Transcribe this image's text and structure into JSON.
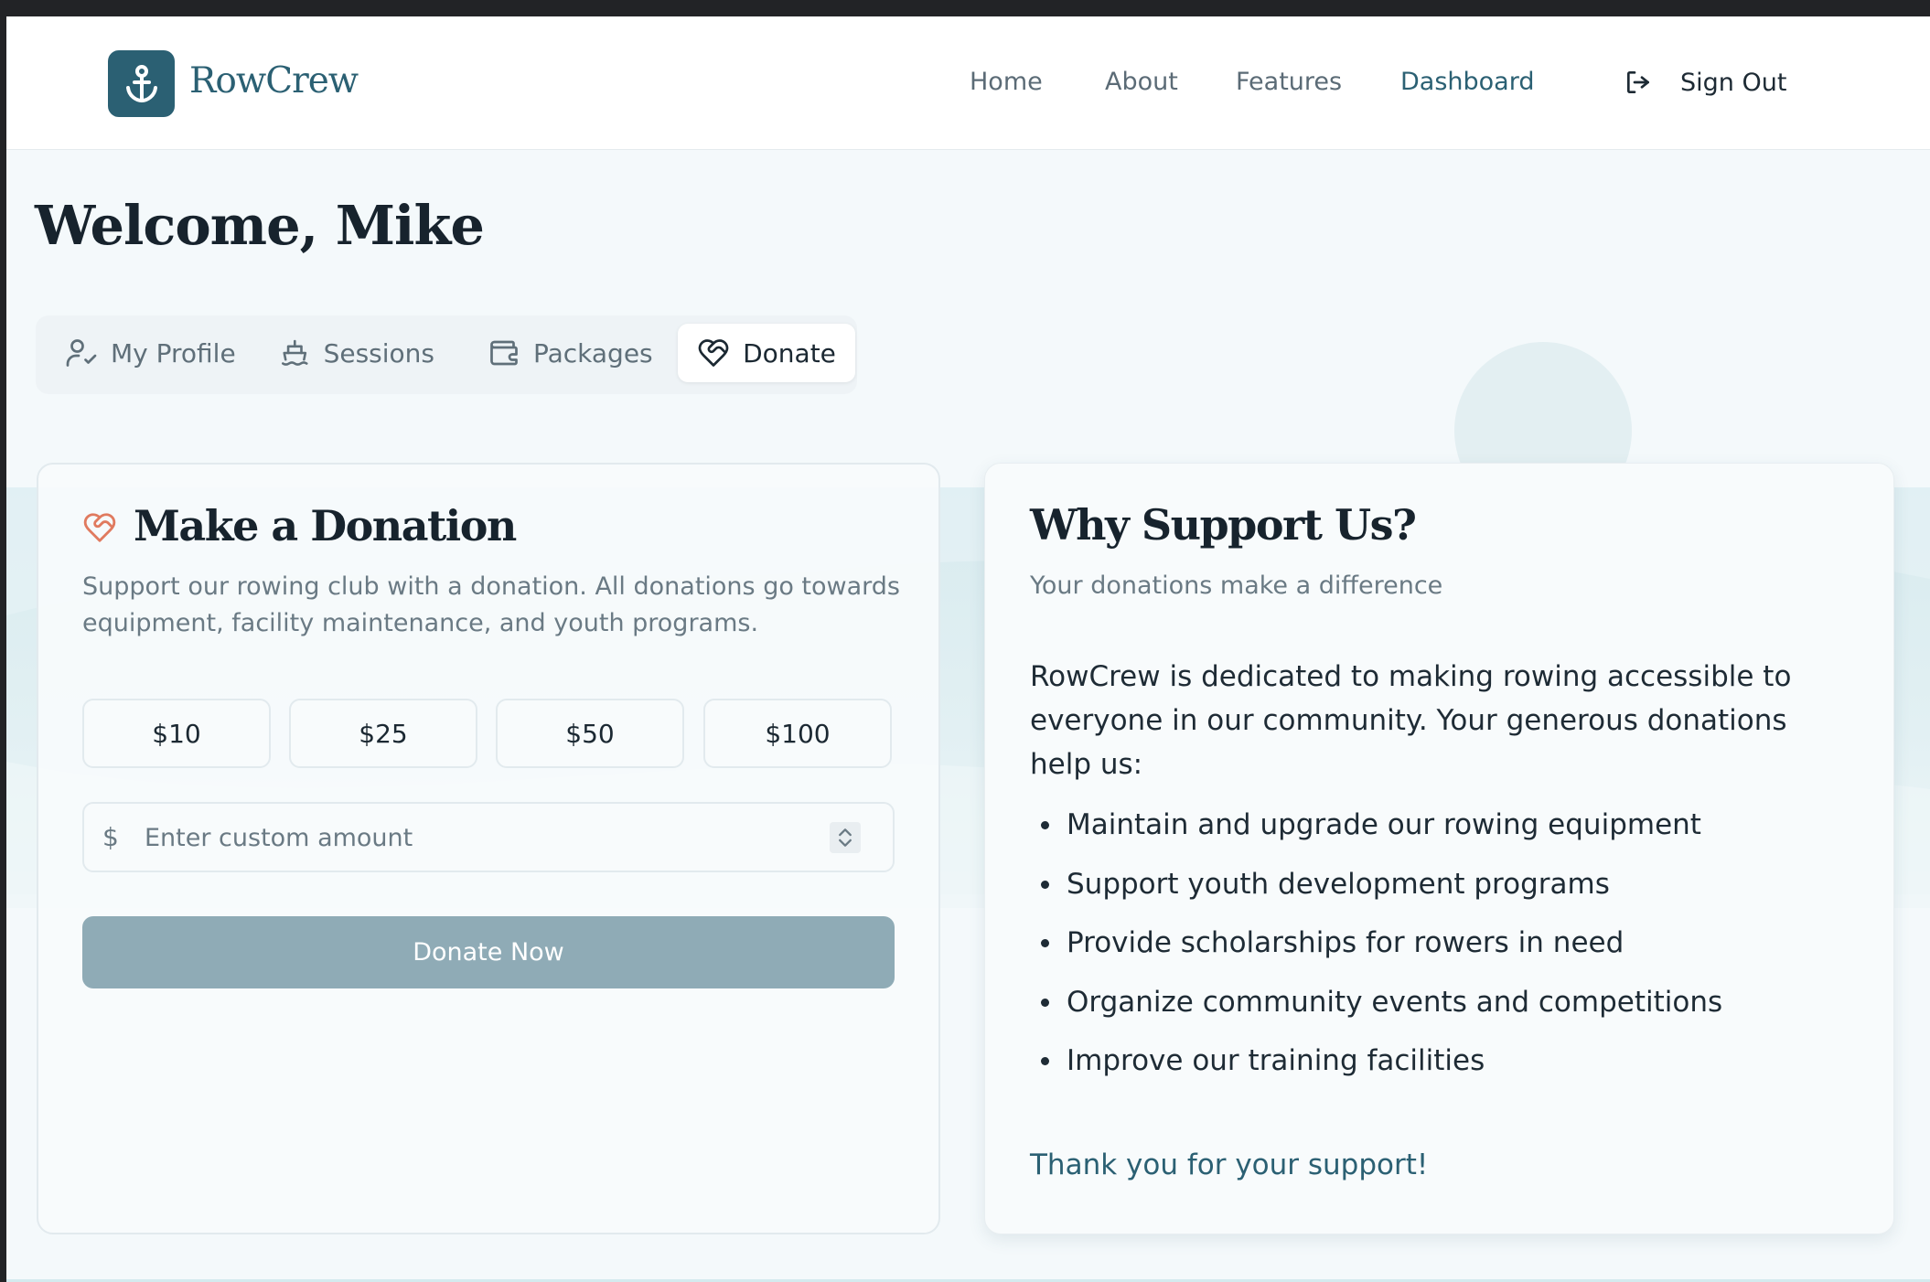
{
  "brand": {
    "name": "RowCrew",
    "logo_icon": "anchor-icon"
  },
  "nav": {
    "links": [
      {
        "label": "Home"
      },
      {
        "label": "About"
      },
      {
        "label": "Features"
      },
      {
        "label": "Dashboard",
        "active": true
      }
    ],
    "signout_label": "Sign Out"
  },
  "welcome": {
    "title": "Welcome, Mike"
  },
  "tabs": [
    {
      "label": "My Profile",
      "icon": "user-check-icon"
    },
    {
      "label": "Sessions",
      "icon": "ship-icon"
    },
    {
      "label": "Packages",
      "icon": "wallet-icon"
    },
    {
      "label": "Donate",
      "icon": "heart-handshake-icon",
      "active": true
    }
  ],
  "donation": {
    "title": "Make a Donation",
    "description": "Support our rowing club with a donation. All donations go towards equipment, facility maintenance, and youth programs.",
    "amounts": [
      "$10",
      "$25",
      "$50",
      "$100"
    ],
    "currency_symbol": "$",
    "custom_placeholder": "Enter custom amount",
    "custom_value": "",
    "submit_label": "Donate Now"
  },
  "support": {
    "title": "Why Support Us?",
    "subtitle": "Your donations make a difference",
    "body": "RowCrew is dedicated to making rowing accessible to everyone in our community. Your generous donations help us:",
    "benefits": [
      "Maintain and upgrade our rowing equipment",
      "Support youth development programs",
      "Provide scholarships for rowers in need",
      "Organize community events and competitions",
      "Improve our training facilities"
    ],
    "thanks": "Thank you for your support!"
  },
  "colors": {
    "brand": "#2b6073",
    "accent_heart": "#e07a5f",
    "button_disabled": "#8fabb6",
    "page_bg": "#f4f9fb"
  }
}
